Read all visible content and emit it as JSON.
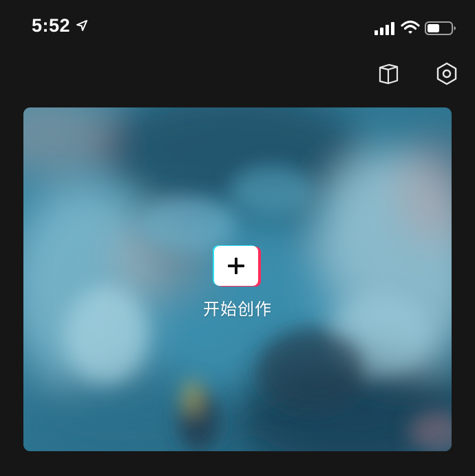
{
  "status_bar": {
    "time": "5:52",
    "icons": [
      "location-arrow-icon",
      "cellular-signal-icon",
      "wifi-icon",
      "battery-icon"
    ]
  },
  "toolbar": {
    "tutorial_icon": "book-icon",
    "settings_icon": "hexagon-gear-icon"
  },
  "create_card": {
    "label": "开始创作",
    "plus_icon": "plus-icon"
  },
  "colors": {
    "background": "#161616",
    "card_tint": "#2c6f88",
    "accent_cyan": "#28e0ee",
    "accent_red": "#ff2b5a"
  }
}
